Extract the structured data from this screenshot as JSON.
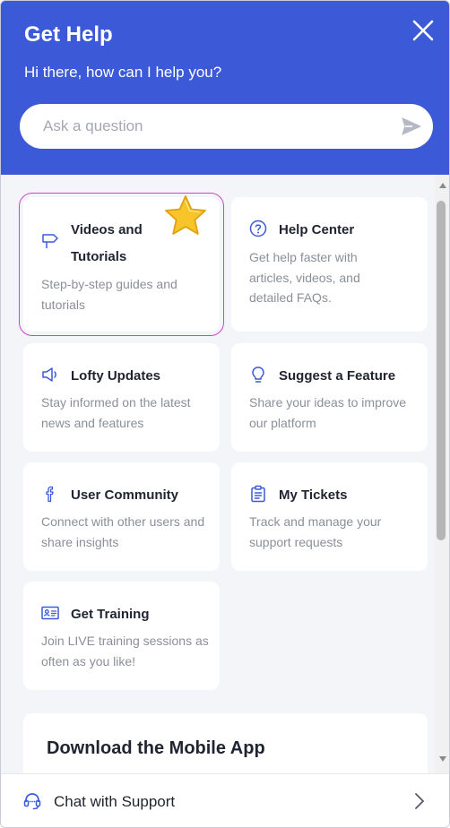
{
  "header": {
    "title": "Get Help",
    "subtitle": "Hi there, how can I help you?"
  },
  "search": {
    "placeholder": "Ask a question"
  },
  "cards": [
    {
      "title": "Videos and Tutorials",
      "desc": "Step-by-step guides and tutorials",
      "icon": "signpost-icon"
    },
    {
      "title": "Help Center",
      "desc": "Get help faster with articles, videos, and detailed FAQs.",
      "icon": "question-circle-icon"
    },
    {
      "title": "Lofty Updates",
      "desc": "Stay informed on the latest news and features",
      "icon": "megaphone-icon"
    },
    {
      "title": "Suggest a Feature",
      "desc": "Share your ideas to improve our platform",
      "icon": "lightbulb-icon"
    },
    {
      "title": "User Community",
      "desc": "Connect with other users and share insights",
      "icon": "facebook-icon"
    },
    {
      "title": "My Tickets",
      "desc": "Track and manage your support requests",
      "icon": "clipboard-icon"
    },
    {
      "title": "Get Training",
      "desc": "Join LIVE training sessions as often as you like!",
      "icon": "id-card-icon"
    }
  ],
  "download": {
    "title": "Download the Mobile App"
  },
  "footer": {
    "label": "Chat with Support"
  },
  "colors": {
    "header_bg": "#3c5ad8",
    "card_bg": "#ffffff",
    "panel_bg": "#f3f5f9",
    "icon_color": "#3c5ad8",
    "highlight_outline": "#cc44cc",
    "star": "#f5c518"
  }
}
